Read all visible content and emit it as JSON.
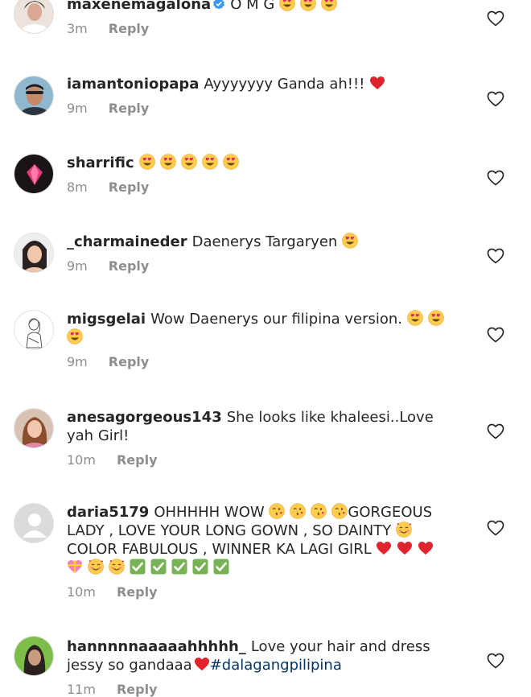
{
  "comments": [
    {
      "username": "maxenemagalona",
      "verified": true,
      "text": "O M G",
      "emojis_after": [
        "heart-eyes",
        "heart-eyes",
        "heart-eyes"
      ],
      "time": "3m",
      "reply": "Reply"
    },
    {
      "username": "iamantoniopapa",
      "text": "Ayyyyyyy Ganda ah!!!",
      "emojis_after": [
        "red-heart"
      ],
      "time": "9m",
      "reply": "Reply"
    },
    {
      "username": "sharrific",
      "text": "",
      "emojis_after": [
        "heart-eyes",
        "heart-eyes",
        "heart-eyes",
        "heart-eyes",
        "heart-eyes"
      ],
      "time": "8m",
      "reply": "Reply"
    },
    {
      "username": "_charmaineder",
      "text": "Daenerys Targaryen",
      "emojis_after": [
        "heart-eyes"
      ],
      "time": "9m",
      "reply": "Reply"
    },
    {
      "username": "migsgelai",
      "text": "Wow Daenerys our filipina version.",
      "emojis_after": [
        "heart-eyes",
        "heart-eyes",
        "heart-eyes"
      ],
      "time": "9m",
      "reply": "Reply"
    },
    {
      "username": "anesagorgeous143",
      "text": "She looks like khaleesi..Love yah Girl!",
      "time": "10m",
      "reply": "Reply"
    },
    {
      "username": "daria5179",
      "text_parts": [
        "OHHHHH WOW",
        "GORGEOUS LADY , LOVE YOUR LONG GOWN , SO DAINTY",
        "COLOR FABULOUS , WINNER KA LAGI GIRL"
      ],
      "time": "10m",
      "reply": "Reply"
    },
    {
      "username": "hannnnnaaaaahhhhh_",
      "text": "Love your hair and dress jessy so gandaaa",
      "hashtag": "#dalagangpilipina",
      "time": "11m",
      "reply": "Reply"
    }
  ],
  "colors": {
    "text": "#262626",
    "meta": "#8e8e8e",
    "hashtag": "#003569",
    "verified": "#3897f0",
    "heart_outline": "#262626"
  }
}
